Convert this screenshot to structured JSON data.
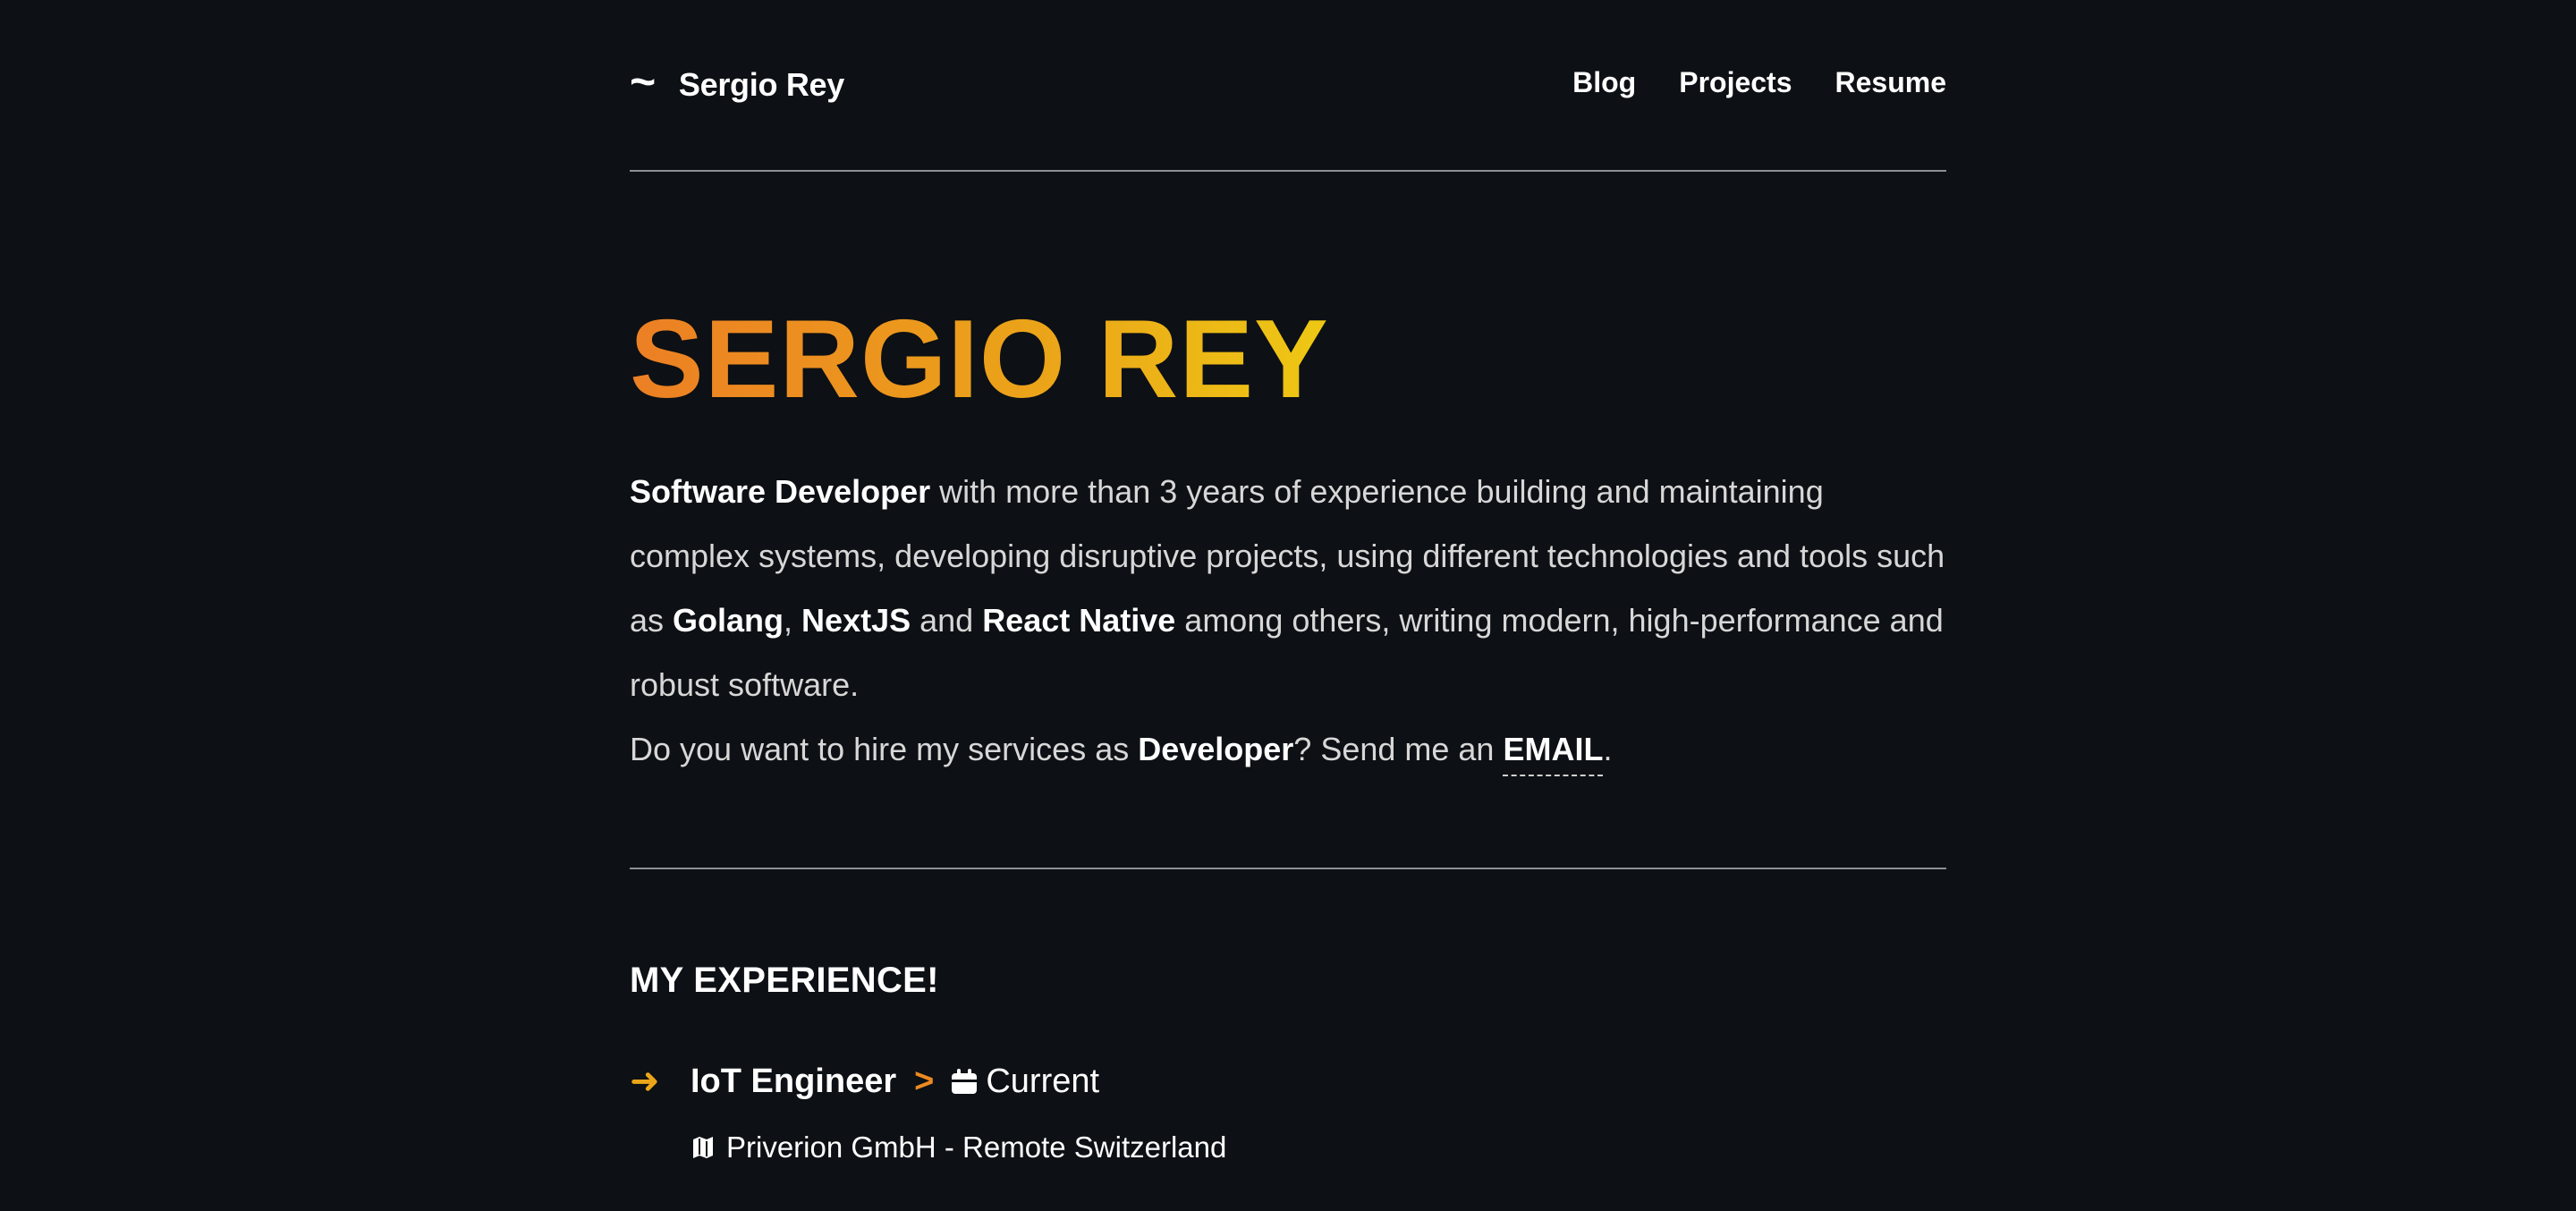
{
  "header": {
    "brand_icon": "~",
    "brand_name": "Sergio Rey",
    "nav": [
      "Blog",
      "Projects",
      "Resume"
    ]
  },
  "hero": {
    "title": "SERGIO REY",
    "bio": {
      "role": "Software Developer",
      "text1": " with more than 3 years of experience building and maintaining complex systems, developing disruptive projects, using different technologies and tools such as ",
      "tech1": "Golang",
      "sep1": ", ",
      "tech2": "NextJS",
      "sep2": " and ",
      "tech3": "React Native",
      "text2": " among others, writing modern, high-performance and robust software."
    },
    "hire": {
      "text1": "Do you want to hire my services as ",
      "role": "Developer",
      "text2": "? Send me an ",
      "email_label": "EMAIL",
      "text3": "."
    }
  },
  "experience": {
    "title": "MY EXPERIENCE!",
    "items": [
      {
        "arrow": "➜",
        "role": "IoT Engineer",
        "separator": ">",
        "date": "Current",
        "company": "Priverion GmbH - Remote Switzerland"
      }
    ]
  },
  "colors": {
    "background": "#0d1014",
    "accent_orange": "#ec7f24",
    "accent_yellow": "#eec814"
  },
  "icons": {
    "calendar": "calendar-icon",
    "map": "map-icon"
  }
}
